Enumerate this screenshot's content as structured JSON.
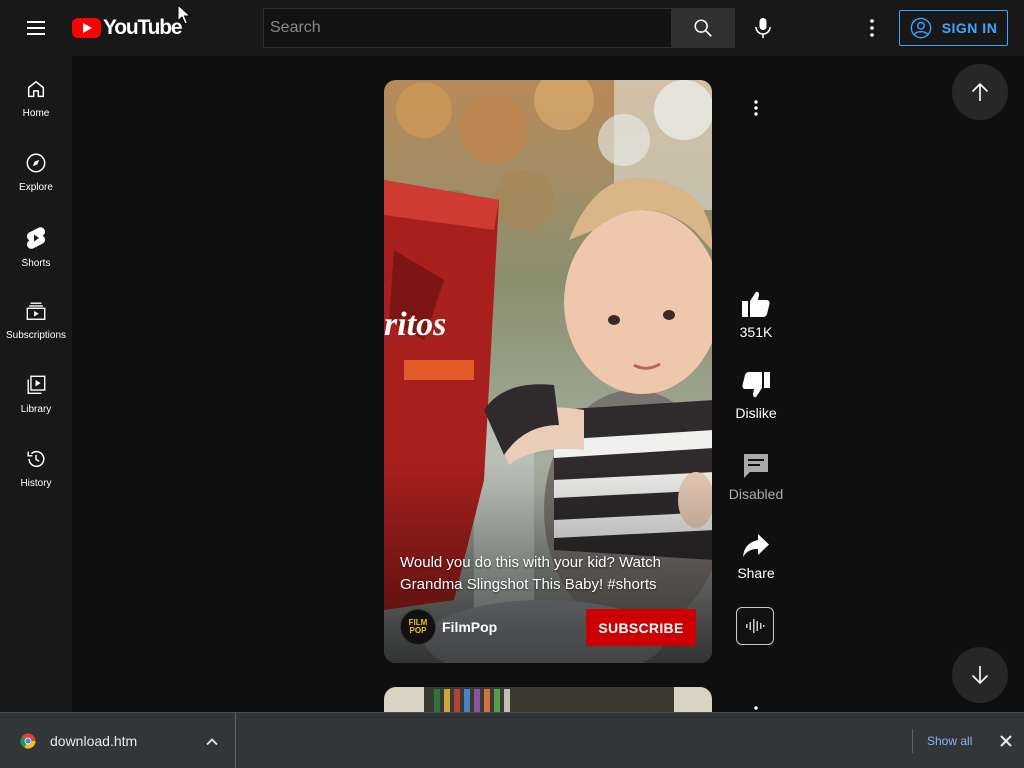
{
  "header": {
    "logo_text": "YouTube",
    "search_placeholder": "Search",
    "signin_label": "SIGN IN"
  },
  "sidebar": {
    "items": [
      {
        "label": "Home",
        "icon": "home-icon"
      },
      {
        "label": "Explore",
        "icon": "compass-icon"
      },
      {
        "label": "Shorts",
        "icon": "shorts-icon"
      },
      {
        "label": "Subscriptions",
        "icon": "subscriptions-icon"
      },
      {
        "label": "Library",
        "icon": "library-icon"
      },
      {
        "label": "History",
        "icon": "history-icon"
      }
    ]
  },
  "short": {
    "caption": "Would you do this with your kid? Watch Grandma Slingshot This Baby! #shorts",
    "channel_name": "FilmPop",
    "channel_avatar_line1": "FILM",
    "channel_avatar_line2": "POP",
    "subscribe_label": "SUBSCRIBE",
    "bag_text": "ritos"
  },
  "actions": {
    "like_count": "351K",
    "dislike_label": "Dislike",
    "comments_label": "Disabled",
    "share_label": "Share"
  },
  "download_bar": {
    "filename": "download.htm",
    "show_all_label": "Show all"
  },
  "colors": {
    "accent_blue": "#3ea6ff",
    "subscribe_red": "#cc0000",
    "youtube_red": "#ff0000",
    "background": "#0f0f0f"
  }
}
